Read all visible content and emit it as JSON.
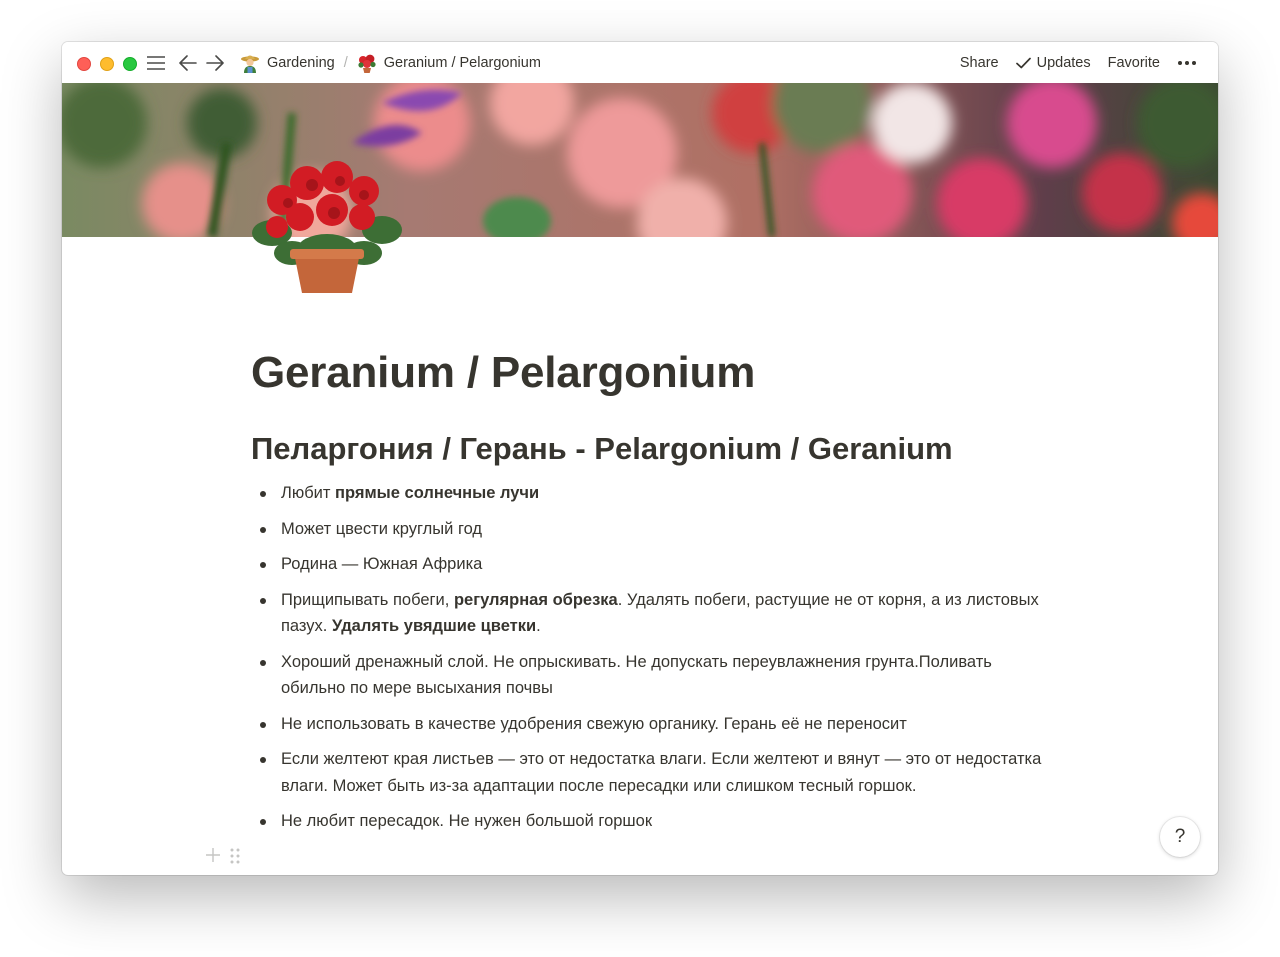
{
  "topbar": {
    "breadcrumbs": [
      {
        "label": "Gardening",
        "icon": "gardener-emoji-icon"
      },
      {
        "label": "Geranium / Pelargonium",
        "icon": "geranium-emoji-icon"
      }
    ],
    "separator": "/",
    "share_label": "Share",
    "updates_label": "Updates",
    "favorite_label": "Favorite"
  },
  "page": {
    "title": "Geranium / Pelargonium",
    "heading": "Пеларгония / Герань - Pelargonium / Geranium",
    "bullets": [
      {
        "parts": [
          {
            "text": "Любит ",
            "bold": false
          },
          {
            "text": "прямые солнечные лучи",
            "bold": true
          }
        ]
      },
      {
        "parts": [
          {
            "text": "Может цвести круглый год",
            "bold": false
          }
        ]
      },
      {
        "parts": [
          {
            "text": "Родина — Южная Африка",
            "bold": false
          }
        ]
      },
      {
        "parts": [
          {
            "text": "Прищипывать побеги, ",
            "bold": false
          },
          {
            "text": "регулярная обрезка",
            "bold": true
          },
          {
            "text": ". Удалять побеги, растущие не от корня, а из листовых пазух. ",
            "bold": false
          },
          {
            "text": "Удалять увядшие цветки",
            "bold": true
          },
          {
            "text": ".",
            "bold": false
          }
        ]
      },
      {
        "parts": [
          {
            "text": "Хороший дренажный слой. Не опрыскивать. Не допускать переувлажнения грунта.Поливать обильно по мере высыхания почвы",
            "bold": false
          }
        ]
      },
      {
        "parts": [
          {
            "text": "Не использовать в качестве удобрения свежую органику. Герань её не переносит",
            "bold": false
          }
        ]
      },
      {
        "parts": [
          {
            "text": "Если желтеют края листьев — это от недостатка влаги. Если желтеют и вянут — это от недостатка влаги. Может быть из-за адаптации после пересадки или слишком тесный горшок.",
            "bold": false
          }
        ]
      },
      {
        "parts": [
          {
            "text": "Не любит пересадок. Не нужен большой горшок",
            "bold": false
          }
        ]
      }
    ]
  },
  "help_label": "?"
}
